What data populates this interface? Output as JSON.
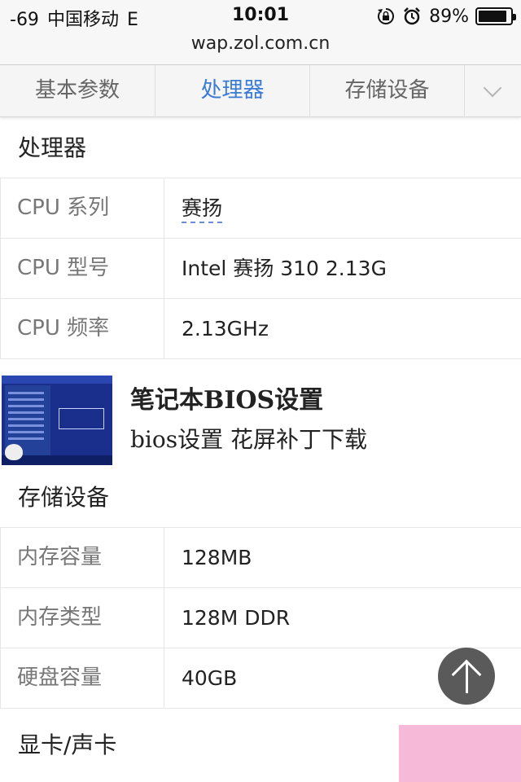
{
  "status_bar": {
    "signal": "-69",
    "carrier": "中国移动",
    "network": "E",
    "time": "10:01",
    "battery_percent": "89%",
    "battery_level": 0.89
  },
  "url": "wap.zol.com.cn",
  "tabs": [
    {
      "label": "基本参数",
      "active": false
    },
    {
      "label": "处理器",
      "active": true
    },
    {
      "label": "存储设备",
      "active": false
    }
  ],
  "processor": {
    "title": "处理器",
    "rows": [
      {
        "key": "CPU 系列",
        "value": "赛扬",
        "link": true
      },
      {
        "key": "CPU 型号",
        "value": "Intel 赛扬 310 2.13G"
      },
      {
        "key": "CPU 频率",
        "value": "2.13GHz"
      }
    ]
  },
  "ad": {
    "title": "笔记本BIOS设置",
    "subtitle": "bios设置 花屏补丁下载"
  },
  "storage": {
    "title": "存储设备",
    "rows": [
      {
        "key": "内存容量",
        "value": "128MB"
      },
      {
        "key": "内存类型",
        "value": "128M DDR"
      },
      {
        "key": "硬盘容量",
        "value": "40GB"
      }
    ]
  },
  "graphics": {
    "title": "显卡/声卡"
  },
  "colors": {
    "active_tab": "#3b7bd4",
    "link_underline": "#6a8fd8",
    "scroll_button": "#5a5a5a"
  },
  "icons": [
    "rotation-lock-icon",
    "alarm-icon",
    "battery-icon",
    "chevron-down-icon",
    "arrow-up-icon"
  ]
}
